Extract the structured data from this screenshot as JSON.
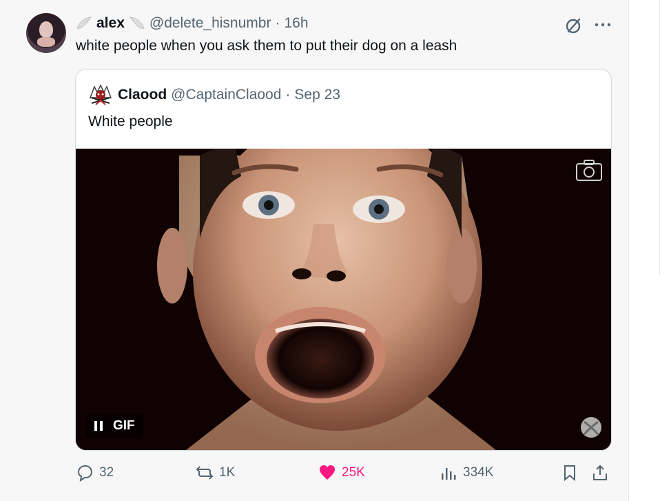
{
  "post": {
    "author": {
      "name": "alex",
      "handle": "@delete_hisnumbr",
      "separator": "·",
      "time": "16h"
    },
    "text": "white people when you ask them to put their dog on a leash",
    "icons": {
      "grok": "grok-icon",
      "more": "more-icon"
    }
  },
  "quote": {
    "author": {
      "name": "Claood",
      "handle": "@CaptainClaood",
      "separator": "·",
      "date": "Sep 23"
    },
    "text": "White people",
    "media": {
      "type": "gif",
      "badge_label": "GIF",
      "pause_icon": "pause-icon",
      "camera_icon": "camera-icon",
      "watermark_icon": "xbox-icon"
    }
  },
  "actions": {
    "replies": "32",
    "reposts": "1K",
    "likes": "25K",
    "views": "334K",
    "bookmark_icon": "bookmark-icon",
    "share_icon": "share-icon"
  },
  "colors": {
    "like": "#f91880",
    "secondary_text": "#536471",
    "primary_text": "#0f1419",
    "border": "#cfd9de"
  }
}
